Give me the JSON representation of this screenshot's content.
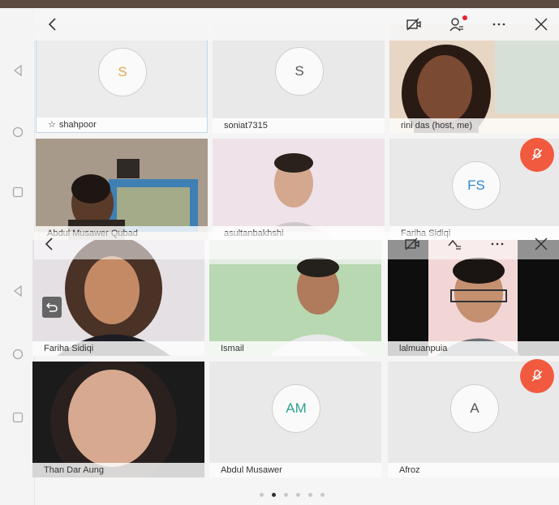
{
  "toolbar": {
    "back_icon": "chevron-left-icon",
    "camera_icon": "camera-off-icon",
    "participants_icon": "participants-icon",
    "more_icon": "more-icon",
    "close_icon": "close-icon"
  },
  "grid_top": [
    {
      "name": "shahpoor",
      "initials": "S",
      "initials_color": "#e5a64a",
      "type": "avatar",
      "starred": true
    },
    {
      "name": "soniat7315",
      "initials": "S",
      "initials_color": "#555555",
      "type": "avatar"
    },
    {
      "name": "rini das (host, me)",
      "type": "video"
    },
    {
      "name": "Abdul Musawer Qubad",
      "type": "video"
    },
    {
      "name": "asultanbakhshi",
      "type": "video"
    },
    {
      "name": "Fariha Sidiqi",
      "initials": "FS",
      "initials_color": "#2e8bd0",
      "type": "avatar",
      "muted": true
    }
  ],
  "grid_bottom": [
    {
      "name": "Fariha Sidiqi",
      "type": "video"
    },
    {
      "name": "Ismail",
      "type": "video"
    },
    {
      "name": "lalmuanpuia",
      "type": "video"
    },
    {
      "name": "Than Dar Aung",
      "type": "video"
    },
    {
      "name": "Abdul Musawer",
      "initials": "AM",
      "initials_color": "#2ea494",
      "type": "avatar"
    },
    {
      "name": "Afroz",
      "initials": "A",
      "initials_color": "#555555",
      "type": "avatar",
      "muted": true
    }
  ],
  "pagination": {
    "total": 6,
    "active_index": 1
  },
  "colors": {
    "muted_badge": "#f15a3f",
    "notification_dot": "#e8202a",
    "selected_border": "#bcd8ee"
  }
}
